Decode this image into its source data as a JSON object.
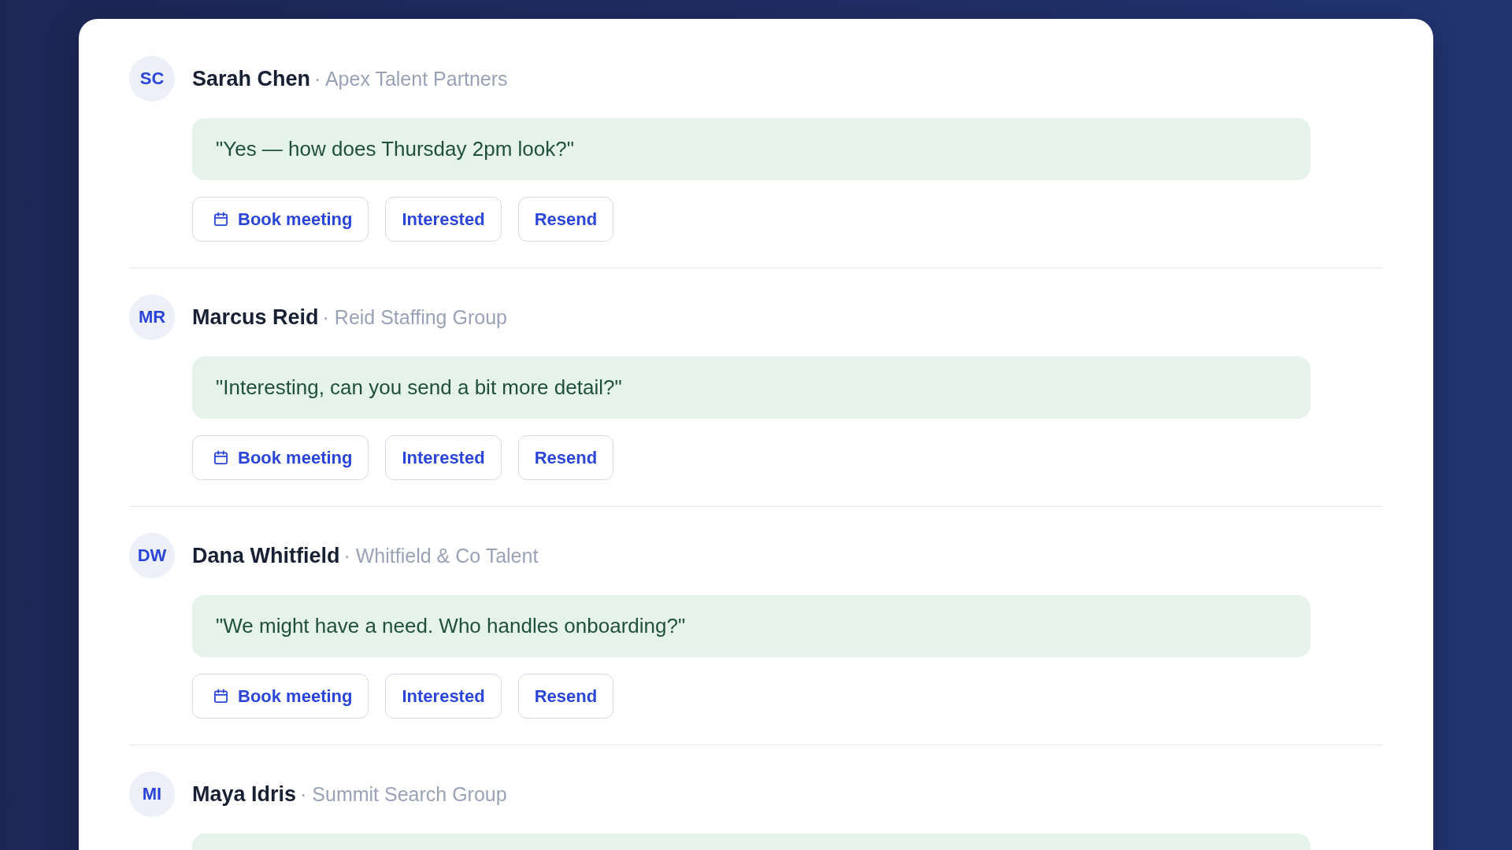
{
  "replies": [
    {
      "initials": "SC",
      "name": "Sarah Chen",
      "company": "· Apex Talent Partners",
      "message": "\"Yes — how does Thursday 2pm look?\"",
      "actions": [
        {
          "label": "Book meeting",
          "kind": "calendar"
        },
        {
          "label": "Interested",
          "kind": "plain"
        },
        {
          "label": "Resend",
          "kind": "plain"
        }
      ]
    },
    {
      "initials": "MR",
      "name": "Marcus Reid",
      "company": "· Reid Staffing Group",
      "message": "\"Interesting, can you send a bit more detail?\"",
      "actions": [
        {
          "label": "Book meeting",
          "kind": "calendar"
        },
        {
          "label": "Interested",
          "kind": "plain"
        },
        {
          "label": "Resend",
          "kind": "plain"
        }
      ]
    },
    {
      "initials": "DW",
      "name": "Dana Whitfield",
      "company": "· Whitfield & Co Talent",
      "message": "\"We might have a need. Who handles onboarding?\"",
      "actions": [
        {
          "label": "Book meeting",
          "kind": "calendar"
        },
        {
          "label": "Interested",
          "kind": "plain"
        },
        {
          "label": "Resend",
          "kind": "plain"
        }
      ]
    },
    {
      "initials": "MI",
      "name": "Maya Idris",
      "company": "· Summit Search Group"
    }
  ]
}
